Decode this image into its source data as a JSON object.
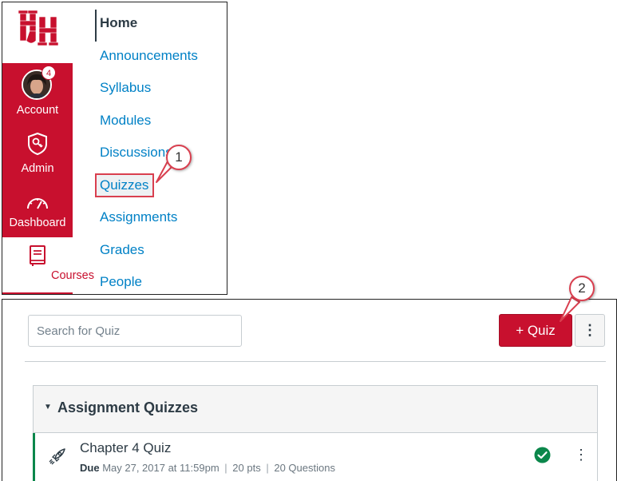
{
  "global_nav": {
    "account_label": "Account",
    "account_badge": "4",
    "admin_label": "Admin",
    "dashboard_label": "Dashboard",
    "courses_label": "Courses"
  },
  "course_nav": {
    "items": [
      "Home",
      "Announcements",
      "Syllabus",
      "Modules",
      "Discussions",
      "Quizzes",
      "Assignments",
      "Grades",
      "People"
    ],
    "active": "Home",
    "highlighted": "Quizzes"
  },
  "callouts": {
    "one": "1",
    "two": "2"
  },
  "quizzes": {
    "search_placeholder": "Search for Quiz",
    "add_button_label": "+ Quiz",
    "more_button_label": "⋮",
    "group_title": "Assignment Quizzes",
    "items": [
      {
        "title": "Chapter 4 Quiz",
        "due_label": "Due",
        "due_date": "May 27, 2017 at 11:59pm",
        "points": "20 pts",
        "questions": "20 Questions",
        "published": true
      }
    ]
  },
  "colors": {
    "brand": "#c8102e",
    "link": "#0081c6",
    "published": "#0b874b",
    "callout_border": "#d93f4f"
  }
}
